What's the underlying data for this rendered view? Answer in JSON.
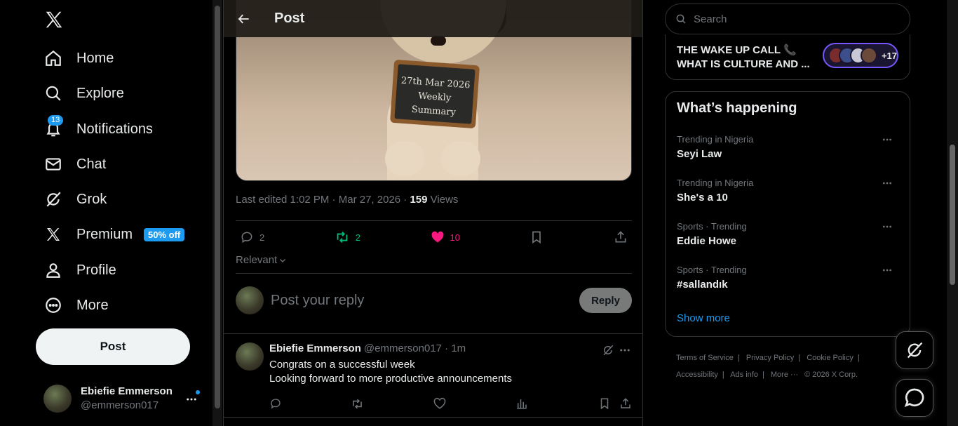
{
  "nav": {
    "items": [
      {
        "label": "Home",
        "icon": "home-icon"
      },
      {
        "label": "Explore",
        "icon": "search-icon"
      },
      {
        "label": "Notifications",
        "icon": "bell-icon",
        "badge": "13"
      },
      {
        "label": "Chat",
        "icon": "mail-icon"
      },
      {
        "label": "Grok",
        "icon": "grok-icon"
      },
      {
        "label": "Premium",
        "icon": "x-icon",
        "badge": "50% off"
      },
      {
        "label": "Profile",
        "icon": "person-icon"
      },
      {
        "label": "More",
        "icon": "more-circle-icon"
      }
    ],
    "post_label": "Post"
  },
  "account": {
    "name": "Ebiefie Emmerson",
    "handle": "@emmerson017"
  },
  "header": {
    "title": "Post"
  },
  "photo": {
    "board_line1": "27th Mar 2026",
    "board_line2": "Weekly Summary"
  },
  "post": {
    "edited": "Last edited 1:02 PM · Mar 27, 2026 · ",
    "views_count": "159",
    "views_label": " Views",
    "replies": "2",
    "reposts": "2",
    "likes": "10",
    "sort": "Relevant"
  },
  "composer": {
    "placeholder": "Post your reply",
    "reply_label": "Reply"
  },
  "reply": {
    "name": "Ebiefie Emmerson",
    "handle": "@emmerson017 · 1m",
    "line1": "Congrats on a successful week",
    "line2": "Looking forward to more productive announcements"
  },
  "search": {
    "placeholder": "Search"
  },
  "spaces": {
    "title": "THE WAKE UP CALL 📞 WHAT IS CULTURE AND ...",
    "count": "+17"
  },
  "trends": {
    "title": "What’s happening",
    "items": [
      {
        "context": "Trending in Nigeria",
        "topic": "Seyi Law"
      },
      {
        "context": "Trending in Nigeria",
        "topic": "She's a 10"
      },
      {
        "context": "Sports · Trending",
        "topic": "Eddie Howe"
      },
      {
        "context": "Sports · Trending",
        "topic": "#sallandık"
      }
    ],
    "show_more": "Show more"
  },
  "footer": {
    "links": [
      "Terms of Service",
      "Privacy Policy",
      "Cookie Policy",
      "Accessibility",
      "Ads info",
      "More ···",
      "© 2026 X Corp."
    ]
  },
  "colors": {
    "accent": "#1d9bf0",
    "like": "#f91880",
    "repost": "#00ba7c",
    "background": "#000000"
  }
}
